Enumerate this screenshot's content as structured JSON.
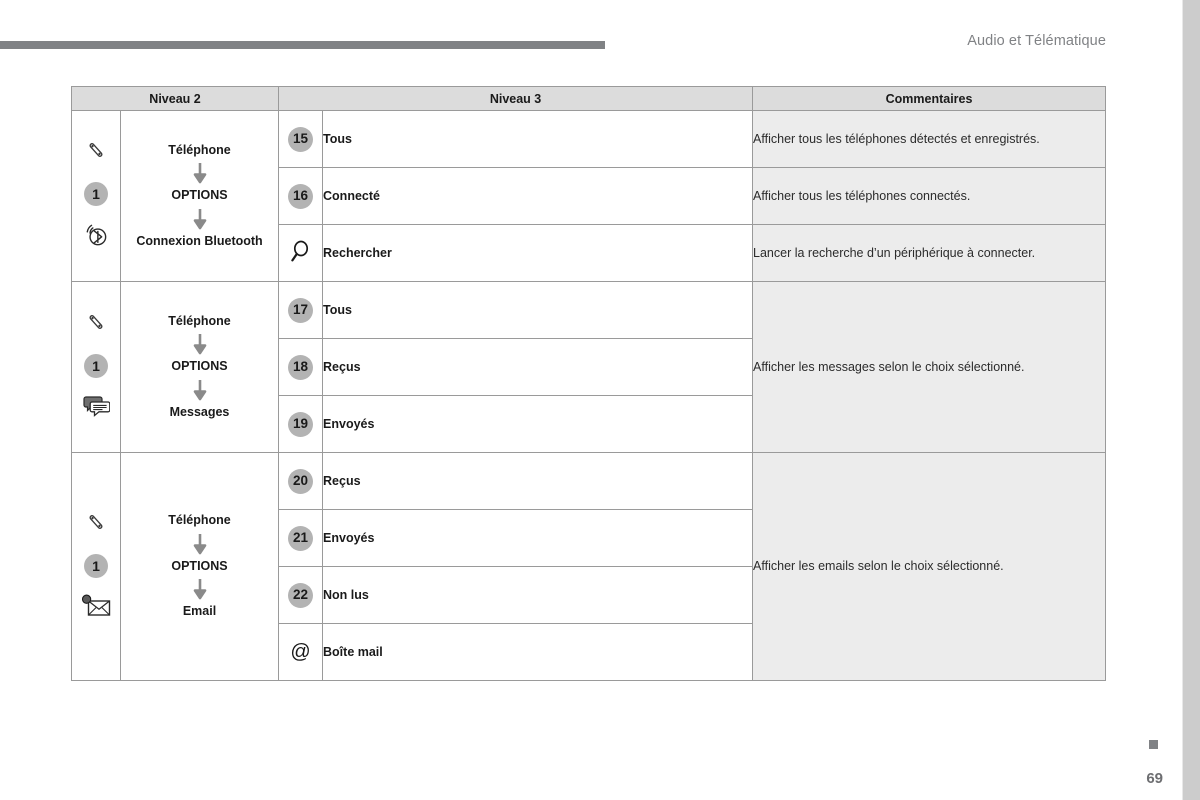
{
  "header": {
    "title": "Audio et Télématique",
    "bar_color": "#808285"
  },
  "footer": {
    "page_number": "69"
  },
  "table": {
    "columns": [
      {
        "key": "niveau2",
        "label": "Niveau 2"
      },
      {
        "key": "niveau3",
        "label": "Niveau 3"
      },
      {
        "key": "commentaires",
        "label": "Commentaires"
      }
    ],
    "groups": [
      {
        "icons": [
          "phone-handset-icon",
          "badge-1",
          "bluetooth-connection-icon"
        ],
        "badge_label": "1",
        "level2_steps": [
          "Téléphone",
          "OPTIONS",
          "Connexion Bluetooth"
        ],
        "rows": [
          {
            "marker": "15",
            "marker_type": "number",
            "label": "Tous",
            "comment": "Afficher tous les téléphones détectés et enregistrés."
          },
          {
            "marker": "search-icon",
            "marker_type": "icon",
            "label": "Connecté",
            "comment": "Afficher tous les téléphones connectés."
          },
          {
            "marker": "16",
            "marker_type": "number",
            "label": "Rechercher",
            "comment": "Lancer la recherche d’un périphérique à connecter."
          }
        ],
        "row_markers": [
          "15",
          "16",
          "search-icon"
        ],
        "row_labels": [
          "Tous",
          "Connecté",
          "Rechercher"
        ],
        "row_comments": [
          "Afficher tous les téléphones détectés et enregistrés.",
          "Afficher tous les téléphones connectés.",
          "Lancer la recherche d’un périphérique à connecter."
        ]
      },
      {
        "icons": [
          "phone-handset-icon",
          "badge-1",
          "messages-bubble-icon"
        ],
        "badge_label": "1",
        "level2_steps": [
          "Téléphone",
          "OPTIONS",
          "Messages"
        ],
        "row_markers": [
          "17",
          "18",
          "19"
        ],
        "row_labels": [
          "Tous",
          "Reçus",
          "Envoyés"
        ],
        "merged_comment": "Afficher les messages selon le choix sélectionné."
      },
      {
        "icons": [
          "phone-handset-icon",
          "badge-1",
          "email-envelope-icon"
        ],
        "badge_label": "1",
        "level2_steps": [
          "Téléphone",
          "OPTIONS",
          "Email"
        ],
        "row_markers": [
          "20",
          "21",
          "22",
          "at-symbol"
        ],
        "row_labels": [
          "Reçus",
          "Envoyés",
          "Non lus",
          "Boîte mail"
        ],
        "merged_comment": "Afficher les emails selon le choix sélectionné."
      }
    ]
  },
  "glyphs": {
    "at_symbol": "@"
  },
  "colors": {
    "header_gray": "#808285",
    "table_header_fill": "#dcdcdc",
    "comment_fill": "#ececec",
    "badge_fill": "#b3b3b3",
    "border": "#9a9a9a",
    "right_strip": "#cccccc"
  }
}
